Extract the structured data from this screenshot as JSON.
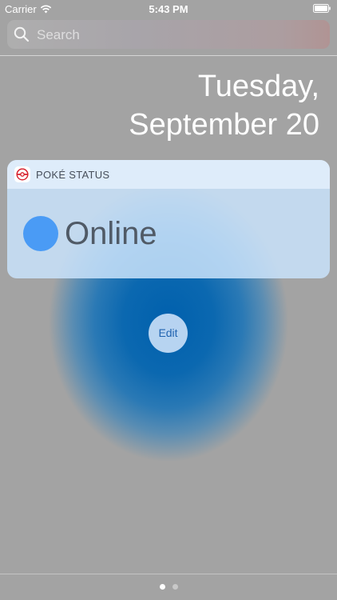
{
  "status_bar": {
    "carrier": "Carrier",
    "time": "5:43 PM"
  },
  "search": {
    "placeholder": "Search"
  },
  "date": {
    "weekday": "Tuesday,",
    "month_day": "September 20"
  },
  "widget": {
    "title": "POKÉ STATUS",
    "status_text": "Online",
    "status_color": "#4a9bf5"
  },
  "edit_label": "Edit",
  "pages": {
    "count": 2,
    "current": 1
  },
  "icons": {
    "wifi": "wifi-icon",
    "battery": "battery-icon",
    "search": "search-icon",
    "app": "pokeball-icon"
  }
}
